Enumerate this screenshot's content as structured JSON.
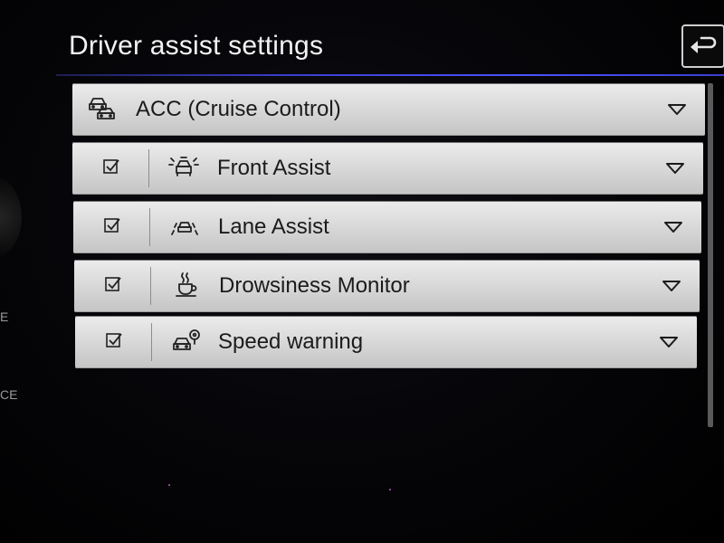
{
  "header": {
    "title": "Driver assist settings"
  },
  "icons": {
    "back": "back-arrow-icon",
    "checkbox": "checkbox-checked-icon",
    "chevron": "chevron-down-icon"
  },
  "bezel": {
    "labels": [
      "E",
      "CE"
    ]
  },
  "rows": [
    {
      "label": "ACC (Cruise Control)",
      "has_checkbox": false,
      "checked": false,
      "icon": "acc-icon"
    },
    {
      "label": "Front Assist",
      "has_checkbox": true,
      "checked": true,
      "icon": "front-assist-icon"
    },
    {
      "label": "Lane Assist",
      "has_checkbox": true,
      "checked": true,
      "icon": "lane-assist-icon"
    },
    {
      "label": "Drowsiness Monitor",
      "has_checkbox": true,
      "checked": true,
      "icon": "coffee-cup-icon"
    },
    {
      "label": "Speed warning",
      "has_checkbox": true,
      "checked": true,
      "icon": "speed-warning-icon"
    }
  ]
}
